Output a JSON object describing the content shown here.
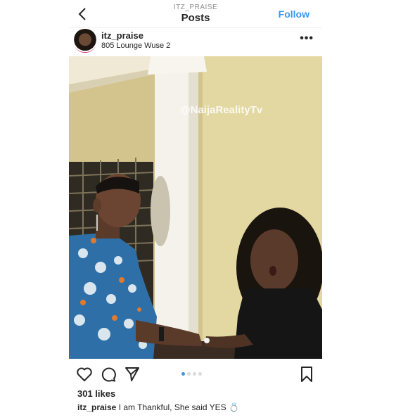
{
  "topbar": {
    "subtitle": "ITZ_PRAISE",
    "title": "Posts",
    "follow_label": "Follow"
  },
  "post": {
    "username": "itz_praise",
    "location": "805 Lounge Wuse 2",
    "watermark": "@NaijaRealityTv",
    "likes": "301 likes",
    "caption_user": "itz_praise",
    "caption_text": "I am Thankful, She said YES 💍",
    "carousel": {
      "total": 4,
      "current": 1
    }
  },
  "icons": {
    "back": "chevron-left-icon",
    "more": "more-options-icon",
    "like": "heart-icon",
    "comment": "comment-icon",
    "share": "send-icon",
    "save": "bookmark-icon"
  },
  "colors": {
    "accent": "#3897f0",
    "text": "#262626",
    "muted": "#8e8e8e"
  }
}
